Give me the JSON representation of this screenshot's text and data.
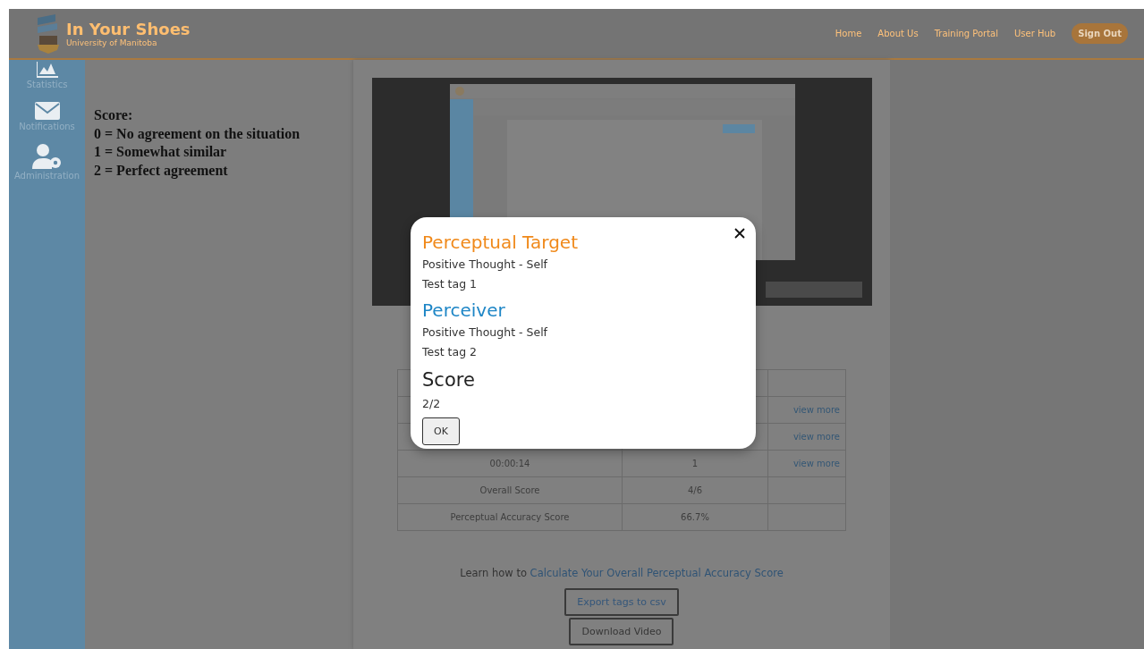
{
  "header": {
    "title": "In Your Shoes",
    "subtitle": "University of Manitoba",
    "nav": [
      {
        "label": "Home"
      },
      {
        "label": "About Us"
      },
      {
        "label": "Training Portal"
      },
      {
        "label": "User Hub"
      }
    ],
    "sign_out": "Sign Out"
  },
  "sidebar": {
    "items": [
      {
        "label": "Statistics",
        "kind": "chart"
      },
      {
        "label": "Notifications",
        "kind": "mail"
      },
      {
        "label": "Administration",
        "kind": "admin"
      }
    ]
  },
  "score_legend": [
    "Score:",
    "0 = No agreement on the situation",
    "1 = Somewhat similar",
    "2 = Perfect agreement"
  ],
  "results_table": {
    "rows": [
      {
        "column_1": "",
        "column_2": "",
        "link": "view more"
      },
      {
        "column_1": "",
        "column_2": "",
        "link": "view more"
      },
      {
        "column_1": "00:00:14",
        "column_2": "1",
        "link": "view more"
      },
      {
        "column_1": "Overall Score",
        "column_2": "4/6",
        "link": ""
      },
      {
        "column_1": "Perceptual Accuracy Score",
        "column_2": "66.7%",
        "link": ""
      }
    ]
  },
  "learn_more": {
    "text": "Learn how to",
    "link": "Calculate Your Overall Perceptual Accuracy Score"
  },
  "buttons": [
    {
      "label": "Export tags to csv",
      "kind": "link"
    },
    {
      "label": "Download Video",
      "kind": "plain"
    }
  ],
  "modal": {
    "sections": [
      {
        "heading": "Perceptual Target",
        "kind": "target",
        "lines": [
          "Positive Thought - Self",
          "Test tag 1"
        ]
      },
      {
        "heading": "Perceiver",
        "kind": "perceiver",
        "lines": [
          "Positive Thought - Self",
          "Test tag 2"
        ]
      },
      {
        "heading": "Score",
        "kind": "score",
        "lines": [
          "2/2"
        ]
      }
    ],
    "ok": "OK"
  }
}
